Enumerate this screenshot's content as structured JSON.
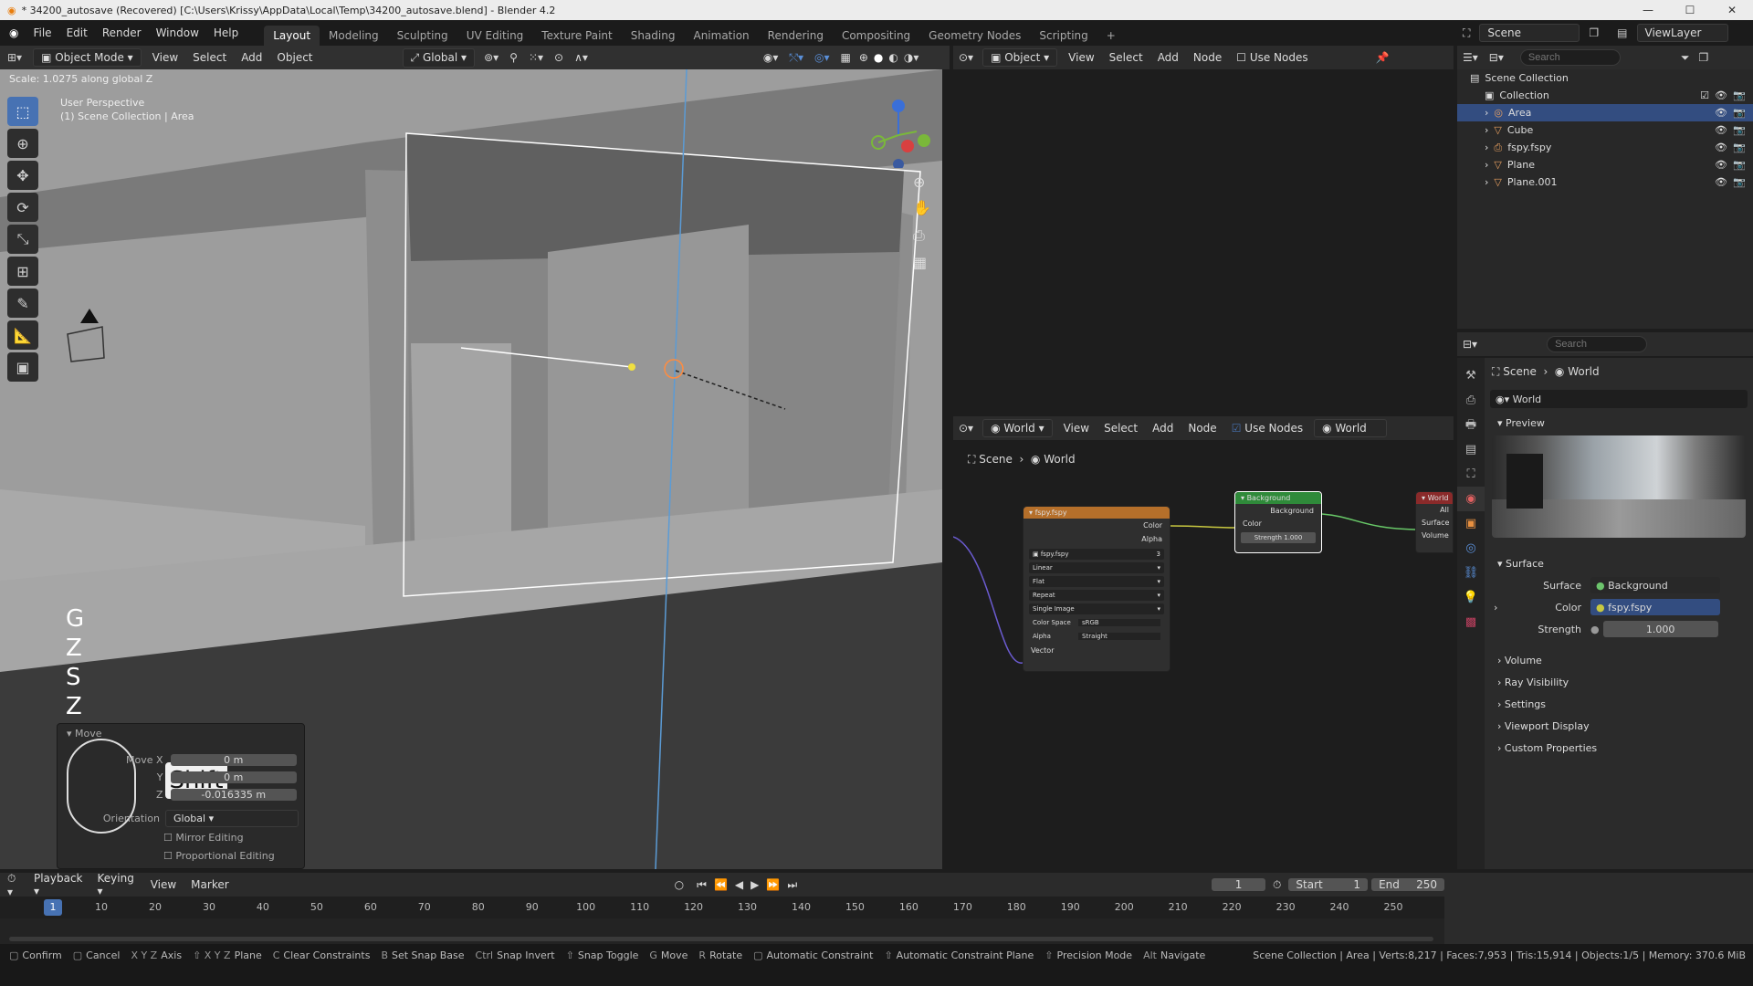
{
  "window": {
    "title": "* 34200_autosave (Recovered) [C:\\Users\\Krissy\\AppData\\Local\\Temp\\34200_autosave.blend] - Blender 4.2",
    "controls": [
      "—",
      "☐",
      "✕"
    ]
  },
  "menu": [
    "File",
    "Edit",
    "Render",
    "Window",
    "Help"
  ],
  "workspaces": [
    "Layout",
    "Modeling",
    "Sculpting",
    "UV Editing",
    "Texture Paint",
    "Shading",
    "Animation",
    "Rendering",
    "Compositing",
    "Geometry Nodes",
    "Scripting"
  ],
  "active_workspace": "Layout",
  "scene": {
    "label": "Scene",
    "view_layer": "ViewLayer"
  },
  "viewport": {
    "mode": "Object Mode",
    "menus": [
      "View",
      "Select",
      "Add",
      "Object"
    ],
    "orientation": "Global",
    "op_text": "Scale: 1.0275 along global Z",
    "perspective": "User Perspective",
    "collection_path": "(1) Scene Collection | Area",
    "keys": [
      "G",
      "Z",
      "S",
      "Z"
    ],
    "shift_label": "Shift",
    "move_panel": {
      "title": "Move",
      "rows": [
        {
          "label": "Move X",
          "value": "0 m"
        },
        {
          "label": "Y",
          "value": "0 m"
        },
        {
          "label": "Z",
          "value": "-0.016335 m"
        }
      ],
      "orientation_label": "Orientation",
      "orientation_value": "Global",
      "mirror": "Mirror Editing",
      "proportional": "Proportional Editing"
    }
  },
  "node_editor_top": {
    "object_dd": "Object",
    "menus": [
      "View",
      "Select",
      "Add",
      "Node"
    ],
    "use_nodes": "Use Nodes"
  },
  "node_editor": {
    "world_dd": "World",
    "menus": [
      "View",
      "Select",
      "Add",
      "Node"
    ],
    "use_nodes": "Use Nodes",
    "world_name": "World",
    "breadcrumb": [
      "Scene",
      "World"
    ],
    "image_node": {
      "title": "fspy.fspy",
      "outputs": [
        "Color",
        "Alpha"
      ],
      "image": "fspy.fspy",
      "users": "3",
      "fields": [
        "Linear",
        "Flat",
        "Repeat",
        "Single Image"
      ],
      "colorspace_label": "Color Space",
      "colorspace": "sRGB",
      "alpha_label": "Alpha",
      "alpha": "Straight",
      "vector": "Vector"
    },
    "bg_node": {
      "title": "Background",
      "output": "Background",
      "color": "Color",
      "strength_label": "Strength",
      "strength": "1.000"
    },
    "out_node": {
      "title": "World",
      "target": "All",
      "surface": "Surface",
      "volume": "Volume"
    }
  },
  "outliner": {
    "search_placeholder": "Search",
    "root": "Scene Collection",
    "collection": "Collection",
    "items": [
      {
        "name": "Area",
        "selected": true
      },
      {
        "name": "Cube",
        "selected": false
      },
      {
        "name": "fspy.fspy",
        "selected": false
      },
      {
        "name": "Plane",
        "selected": false
      },
      {
        "name": "Plane.001",
        "selected": false
      }
    ]
  },
  "properties": {
    "search_placeholder": "Search",
    "breadcrumb": [
      "Scene",
      "World"
    ],
    "world_name": "World",
    "preview_label": "Preview",
    "surface_label": "Surface",
    "surface_field": "Surface",
    "surface_value": "Background",
    "color_field": "Color",
    "color_value": "fspy.fspy",
    "strength_field": "Strength",
    "strength_value": "1.000",
    "sections": [
      "Volume",
      "Ray Visibility",
      "Settings",
      "Viewport Display",
      "Custom Properties"
    ]
  },
  "timeline": {
    "menus": [
      "Playback",
      "Keying",
      "View",
      "Marker"
    ],
    "current_frame": "1",
    "start_label": "Start",
    "start": "1",
    "end_label": "End",
    "end": "250",
    "ticks": [
      "1",
      "10",
      "20",
      "30",
      "40",
      "50",
      "60",
      "70",
      "80",
      "90",
      "100",
      "110",
      "120",
      "130",
      "140",
      "150",
      "160",
      "170",
      "180",
      "190",
      "200",
      "210",
      "220",
      "230",
      "240",
      "250"
    ]
  },
  "statusbar": {
    "hints": [
      {
        "key": "",
        "label": "Confirm"
      },
      {
        "key": "",
        "label": "Cancel"
      },
      {
        "key": "X Y Z",
        "label": "Axis"
      },
      {
        "key": "⇧ X Y Z",
        "label": "Plane"
      },
      {
        "key": "C",
        "label": "Clear Constraints"
      },
      {
        "key": "B",
        "label": "Set Snap Base"
      },
      {
        "key": "Ctrl",
        "label": "Snap Invert"
      },
      {
        "key": "⇧",
        "label": "Snap Toggle"
      },
      {
        "key": "G",
        "label": "Move"
      },
      {
        "key": "R",
        "label": "Rotate"
      },
      {
        "key": "",
        "label": "Automatic Constraint"
      },
      {
        "key": "⇧",
        "label": "Automatic Constraint Plane"
      },
      {
        "key": "⇧",
        "label": "Precision Mode"
      },
      {
        "key": "Alt",
        "label": "Navigate"
      }
    ],
    "stats": "Scene Collection | Area | Verts:8,217 | Faces:7,953 | Tris:15,914 | Objects:1/5 | Memory: 370.6 MiB"
  },
  "colors": {
    "accent": "#4772b3",
    "selected_row": "#334d80",
    "world_red": "#c0392b"
  }
}
